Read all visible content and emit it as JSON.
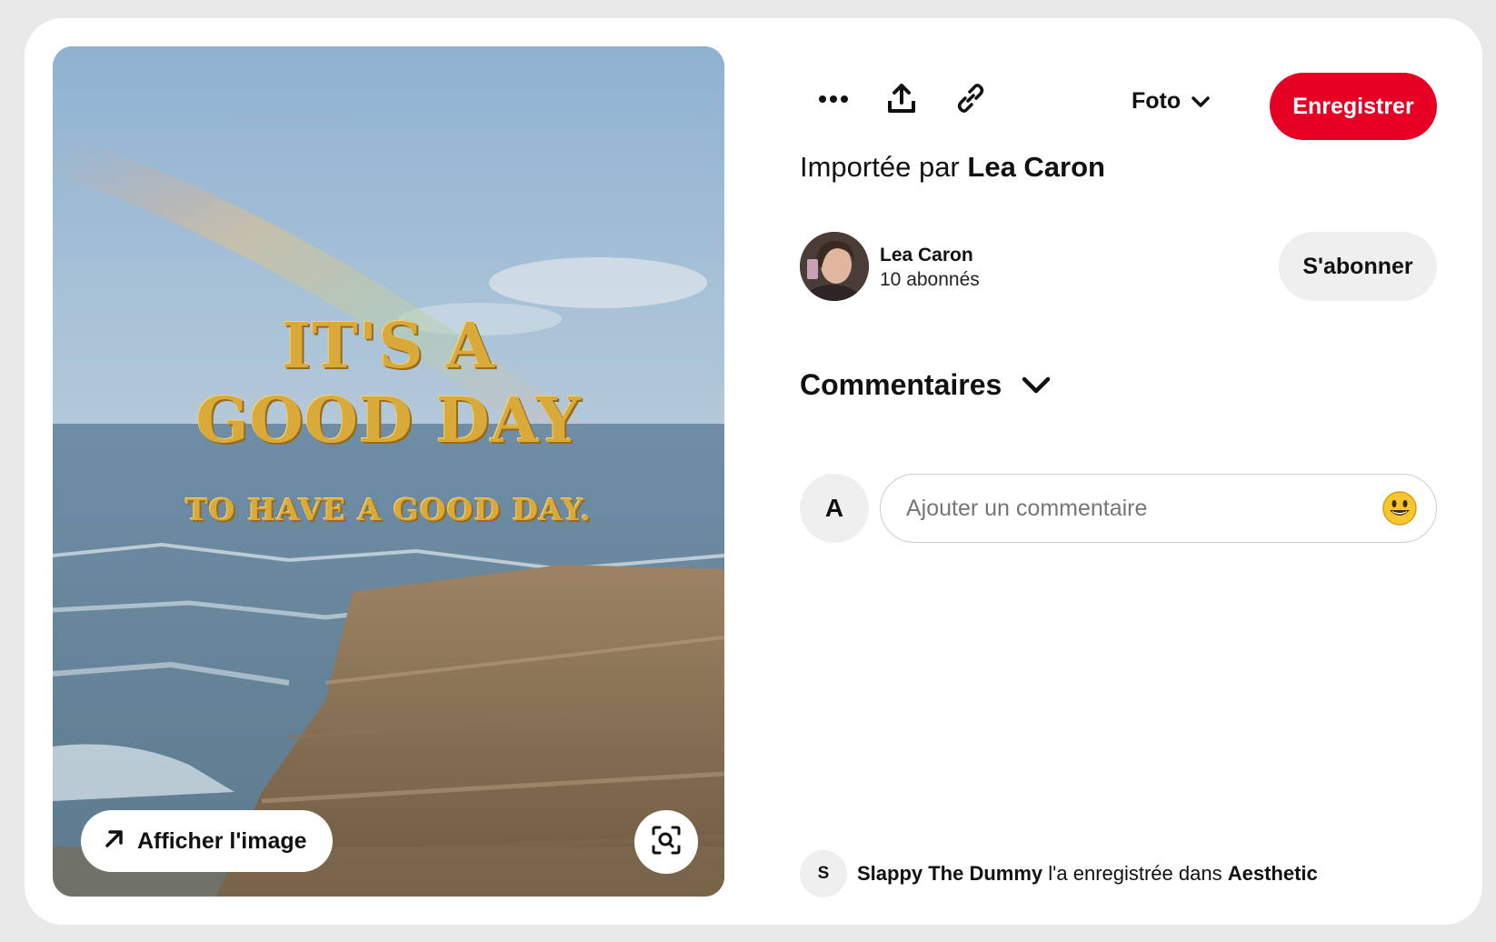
{
  "pin": {
    "image_text": {
      "line1": "IT'S A",
      "line2": "GOOD DAY",
      "line3": "TO HAVE A GOOD DAY."
    },
    "view_image_label": "Afficher l'image"
  },
  "toolbar": {
    "more_icon": "more-horizontal-icon",
    "share_icon": "share-upload-icon",
    "link_icon": "link-icon",
    "board_label": "Foto",
    "save_label": "Enregistrer"
  },
  "uploaded": {
    "prefix": "Importée par",
    "name": "Lea Caron"
  },
  "creator": {
    "name": "Lea Caron",
    "followers": "10 abonnés",
    "follow_label": "S'abonner"
  },
  "comments": {
    "heading": "Commentaires",
    "user_initial": "A",
    "placeholder": "Ajouter un commentaire"
  },
  "saved_by": {
    "initial": "S",
    "user": "Slappy The Dummy",
    "middle": "l'a enregistrée dans",
    "board": "Aesthetic"
  },
  "colors": {
    "accent": "#e60023",
    "secondary_button": "#efefef",
    "background": "#e9e9e9"
  }
}
